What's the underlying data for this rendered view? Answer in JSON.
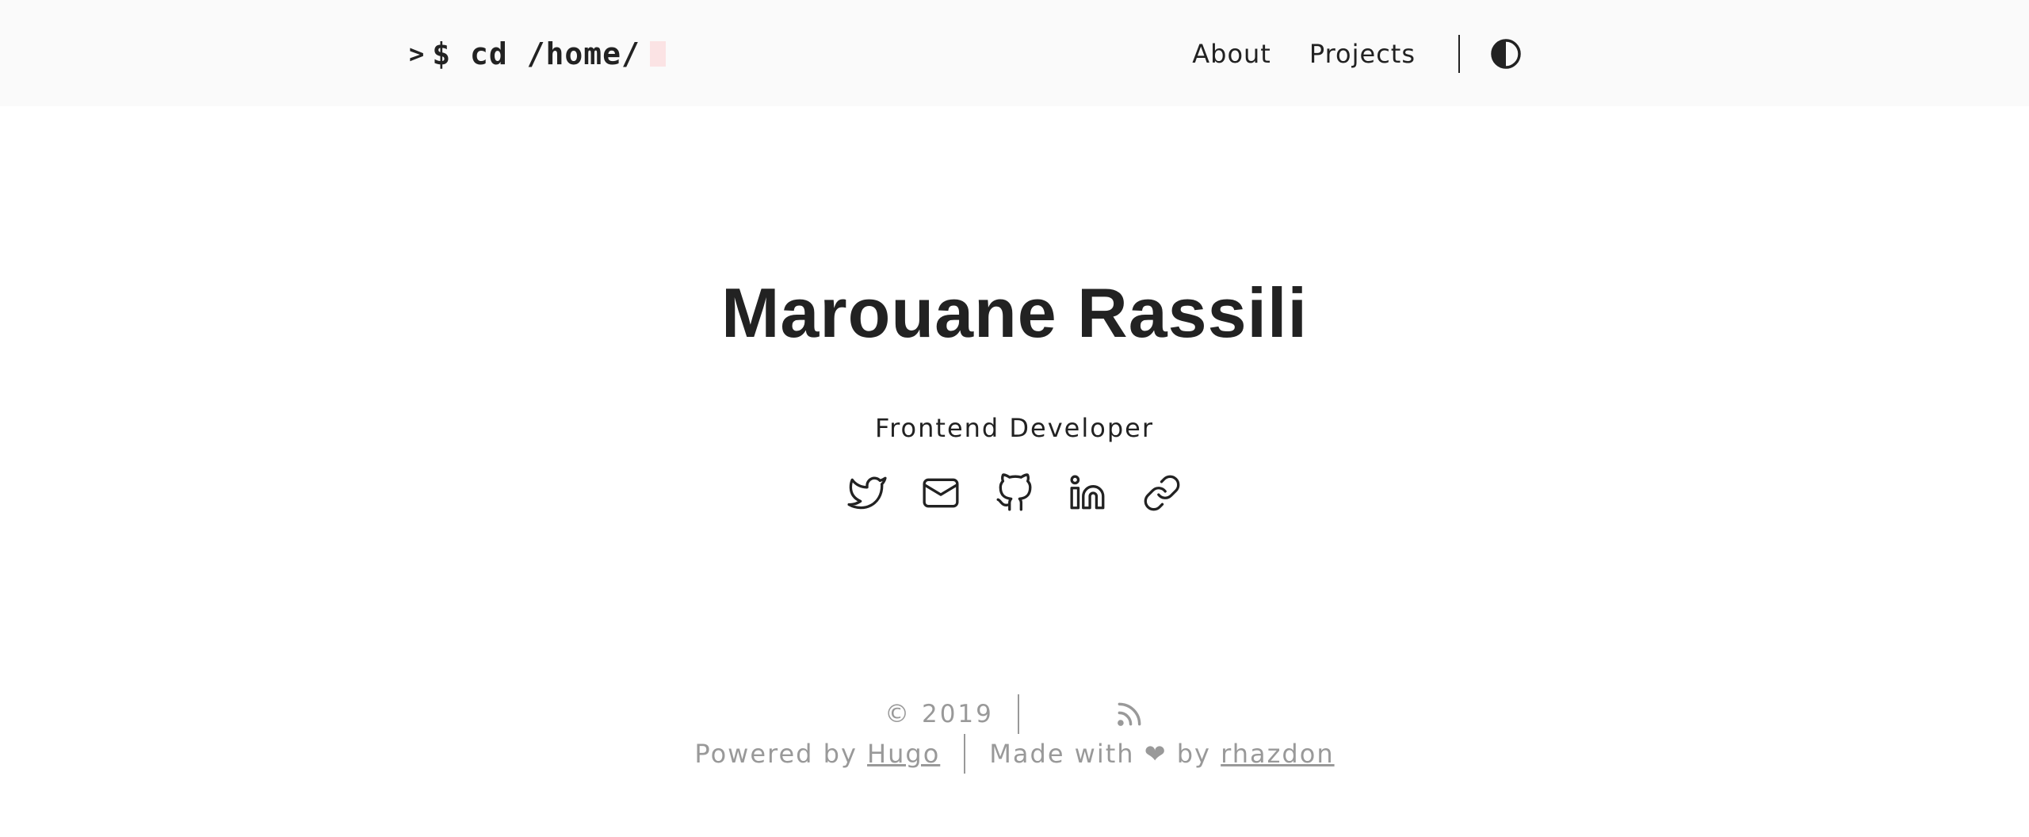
{
  "header": {
    "logo": {
      "caret": ">",
      "text": "$ cd /home/"
    },
    "nav": [
      {
        "label": "About"
      },
      {
        "label": "Projects"
      }
    ],
    "theme_toggle_icon": "contrast-icon"
  },
  "main": {
    "name": "Marouane Rassili",
    "subtitle": "Frontend Developer",
    "socials": [
      {
        "icon": "twitter-icon"
      },
      {
        "icon": "mail-icon"
      },
      {
        "icon": "github-icon"
      },
      {
        "icon": "linkedin-icon"
      },
      {
        "icon": "link-icon"
      }
    ]
  },
  "footer": {
    "copyright": "© 2019",
    "rss_icon": "rss-icon",
    "powered_by_prefix": "Powered by",
    "powered_by_link": "Hugo",
    "made_with_prefix": "Made with ❤ by",
    "made_with_link": "rhazdon"
  },
  "colors": {
    "text": "#222222",
    "muted": "#999999",
    "header_bg": "#fafafa",
    "cursor": "#fbe3e4"
  }
}
